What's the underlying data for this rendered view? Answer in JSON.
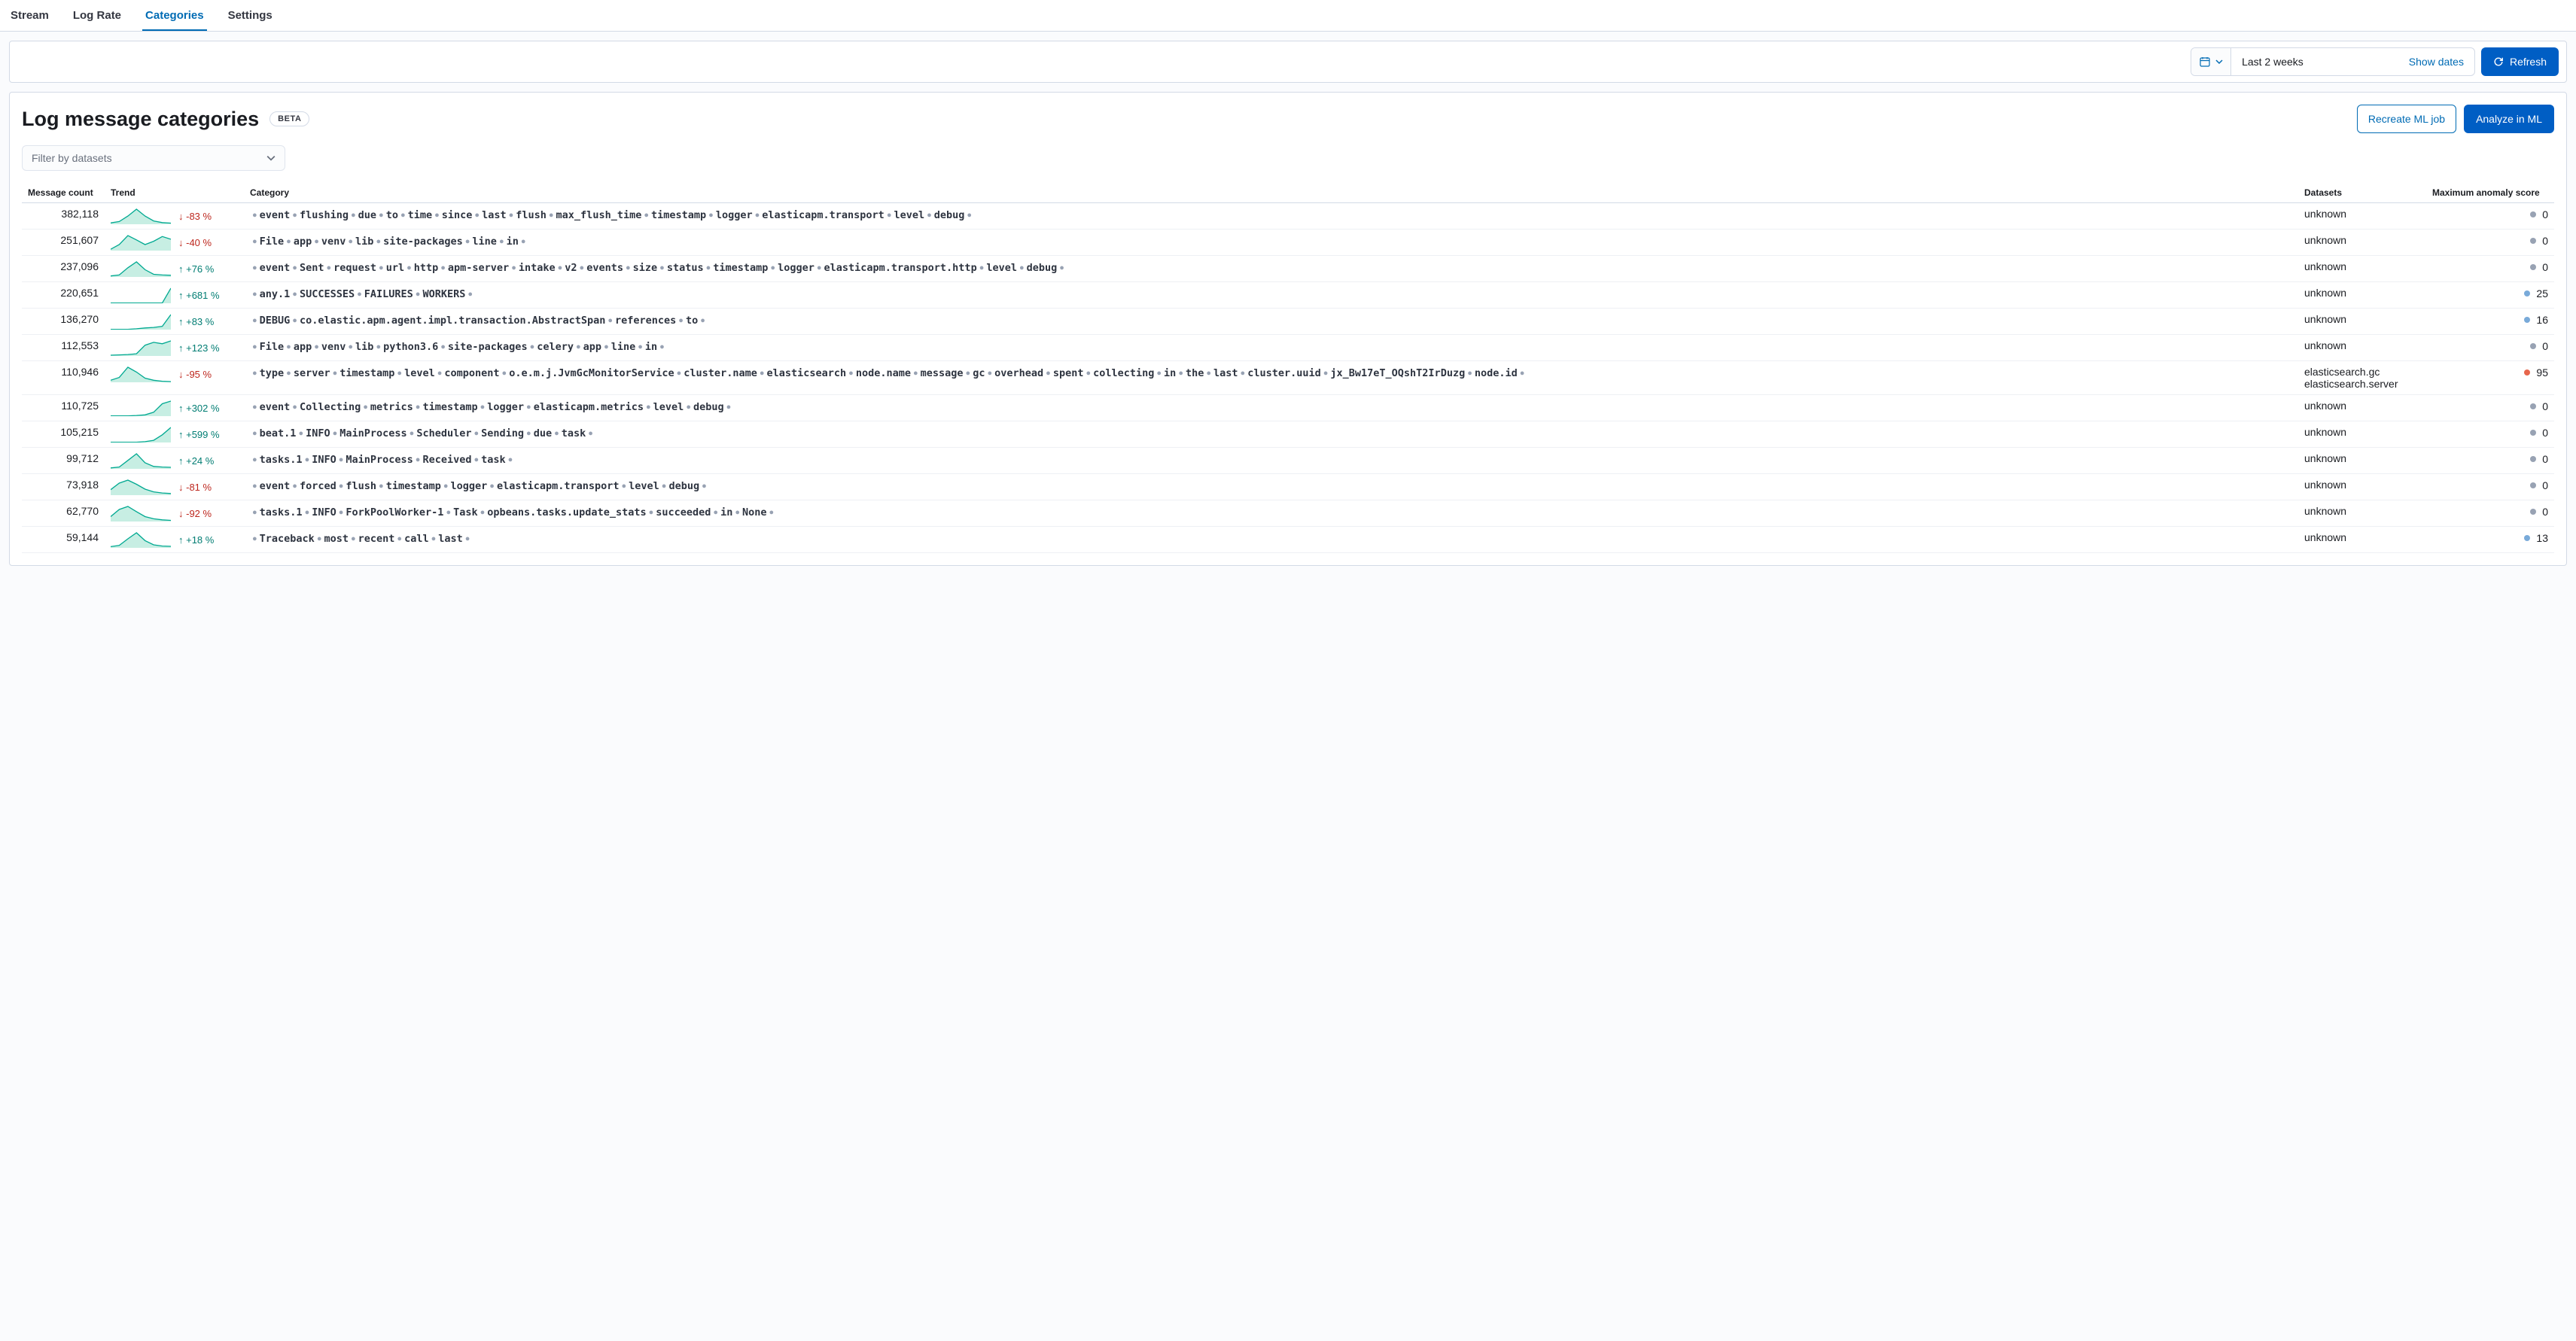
{
  "tabs": {
    "stream": "Stream",
    "log_rate": "Log Rate",
    "categories": "Categories",
    "settings": "Settings",
    "active": "Categories"
  },
  "toolbar": {
    "range_label": "Last 2 weeks",
    "show_dates": "Show dates",
    "refresh": "Refresh"
  },
  "panel": {
    "title": "Log message categories",
    "badge": "BETA",
    "recreate": "Recreate ML job",
    "analyze": "Analyze in ML",
    "filter_placeholder": "Filter by datasets"
  },
  "columns": {
    "message_count": "Message count",
    "trend": "Trend",
    "category": "Category",
    "datasets": "Datasets",
    "score": "Maximum anomaly score"
  },
  "colors": {
    "none": "#98a2b3",
    "low": "#79aad9",
    "high": "#e7664c"
  },
  "rows": [
    {
      "count": "382,118",
      "trend": -83,
      "tokens": [
        "event",
        "flushing",
        "due",
        "to",
        "time",
        "since",
        "last",
        "flush",
        "max_flush_time",
        "timestamp",
        "logger",
        "elasticapm.transport",
        "level",
        "debug"
      ],
      "datasets": "unknown",
      "score": 0,
      "severity": "none",
      "spark": [
        5,
        10,
        30,
        55,
        30,
        12,
        6,
        4
      ]
    },
    {
      "count": "251,607",
      "trend": -40,
      "tokens": [
        "File",
        "app",
        "venv",
        "lib",
        "site-packages",
        "line",
        "in"
      ],
      "datasets": "unknown",
      "score": 0,
      "severity": "none",
      "spark": [
        4,
        18,
        45,
        32,
        18,
        28,
        42,
        34
      ]
    },
    {
      "count": "237,096",
      "trend": 76,
      "tokens": [
        "event",
        "Sent",
        "request",
        "url",
        "http",
        "apm-server",
        "intake",
        "v2",
        "events",
        "size",
        "status",
        "timestamp",
        "logger",
        "elasticapm.transport.http",
        "level",
        "debug"
      ],
      "datasets": "unknown",
      "score": 0,
      "severity": "none",
      "spark": [
        3,
        6,
        28,
        46,
        22,
        8,
        6,
        5
      ]
    },
    {
      "count": "220,651",
      "trend": 681,
      "tokens": [
        "any.1",
        "SUCCESSES",
        "FAILURES",
        "WORKERS"
      ],
      "datasets": "unknown",
      "score": 25,
      "severity": "low",
      "spark": [
        1,
        1,
        1,
        1,
        1,
        1,
        1,
        55
      ]
    },
    {
      "count": "136,270",
      "trend": 83,
      "tokens": [
        "DEBUG",
        "co.elastic.apm.agent.impl.transaction.AbstractSpan",
        "references",
        "to"
      ],
      "datasets": "unknown",
      "score": 16,
      "severity": "low",
      "spark": [
        1,
        1,
        1,
        3,
        6,
        8,
        12,
        55
      ]
    },
    {
      "count": "112,553",
      "trend": 123,
      "tokens": [
        "File",
        "app",
        "venv",
        "lib",
        "python3.6",
        "site-packages",
        "celery",
        "app",
        "line",
        "in"
      ],
      "datasets": "unknown",
      "score": 0,
      "severity": "none",
      "spark": [
        2,
        3,
        4,
        6,
        30,
        38,
        34,
        42
      ]
    },
    {
      "count": "110,946",
      "trend": -95,
      "tokens": [
        "type",
        "server",
        "timestamp",
        "level",
        "component",
        "o.e.m.j.JvmGcMonitorService",
        "cluster.name",
        "elasticsearch",
        "node.name",
        "message",
        "gc",
        "overhead",
        "spent",
        "collecting",
        "in",
        "the",
        "last",
        "cluster.uuid",
        "jx_Bw17eT_OQshT2IrDuzg",
        "node.id"
      ],
      "datasets": "elasticsearch.gc\nelasticsearch.server",
      "score": 95,
      "severity": "high",
      "spark": [
        6,
        14,
        44,
        30,
        12,
        6,
        3,
        2
      ]
    },
    {
      "count": "110,725",
      "trend": 302,
      "tokens": [
        "event",
        "Collecting",
        "metrics",
        "timestamp",
        "logger",
        "elasticapm.metrics",
        "level",
        "debug"
      ],
      "datasets": "unknown",
      "score": 0,
      "severity": "none",
      "spark": [
        1,
        1,
        1,
        2,
        4,
        12,
        38,
        46
      ]
    },
    {
      "count": "105,215",
      "trend": 599,
      "tokens": [
        "beat.1",
        "INFO",
        "MainProcess",
        "Scheduler",
        "Sending",
        "due",
        "task"
      ],
      "datasets": "unknown",
      "score": 0,
      "severity": "none",
      "spark": [
        1,
        1,
        1,
        1,
        3,
        8,
        28,
        55
      ]
    },
    {
      "count": "99,712",
      "trend": 24,
      "tokens": [
        "tasks.1",
        "INFO",
        "MainProcess",
        "Received",
        "task"
      ],
      "datasets": "unknown",
      "score": 0,
      "severity": "none",
      "spark": [
        3,
        6,
        28,
        50,
        20,
        8,
        6,
        5
      ]
    },
    {
      "count": "73,918",
      "trend": -81,
      "tokens": [
        "event",
        "forced",
        "flush",
        "timestamp",
        "logger",
        "elasticapm.transport",
        "level",
        "debug"
      ],
      "datasets": "unknown",
      "score": 0,
      "severity": "none",
      "spark": [
        20,
        44,
        55,
        40,
        22,
        12,
        8,
        6
      ]
    },
    {
      "count": "62,770",
      "trend": -92,
      "tokens": [
        "tasks.1",
        "INFO",
        "ForkPoolWorker-1",
        "Task",
        "opbeans.tasks.update_stats",
        "succeeded",
        "in",
        "None"
      ],
      "datasets": "unknown",
      "score": 0,
      "severity": "none",
      "spark": [
        18,
        44,
        55,
        36,
        18,
        10,
        6,
        4
      ]
    },
    {
      "count": "59,144",
      "trend": 18,
      "tokens": [
        "Traceback",
        "most",
        "recent",
        "call",
        "last"
      ],
      "datasets": "unknown",
      "score": 13,
      "severity": "low",
      "spark": [
        4,
        8,
        30,
        50,
        24,
        10,
        6,
        5
      ]
    }
  ]
}
